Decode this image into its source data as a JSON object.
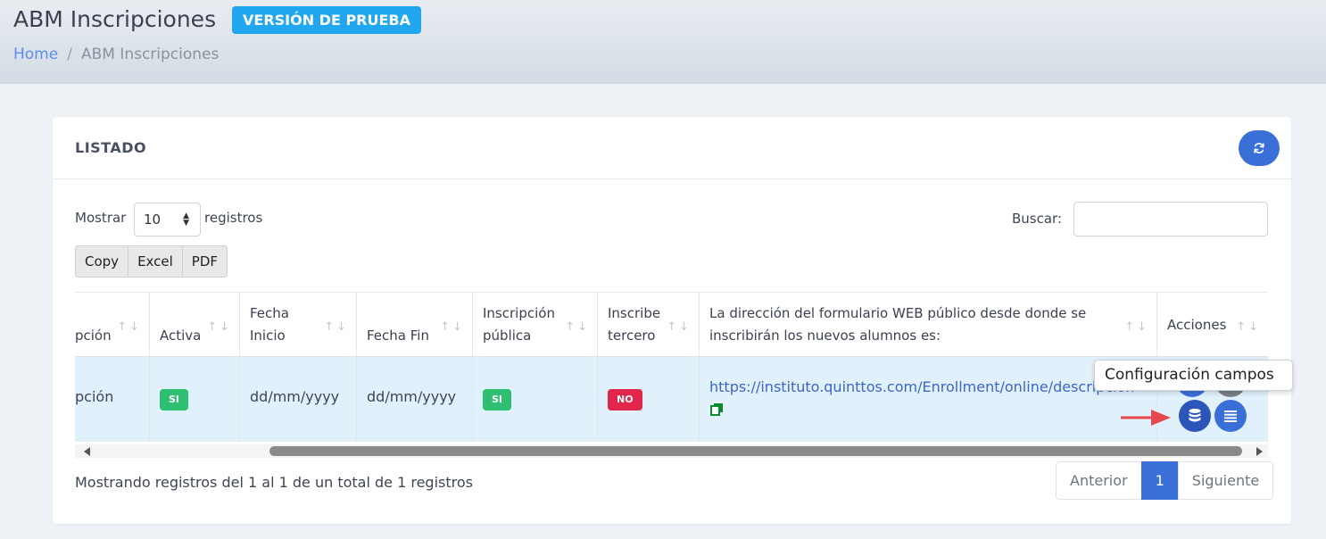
{
  "header": {
    "title": "ABM Inscripciones",
    "trial_badge": "VERSIÓN DE PRUEBA",
    "breadcrumb": {
      "home": "Home",
      "separator": "/",
      "current": "ABM Inscripciones"
    }
  },
  "card": {
    "title": "LISTADO",
    "refresh_icon": "refresh-icon"
  },
  "controls": {
    "show_label": "Mostrar",
    "page_length": "10",
    "records_label": "registros",
    "search_label": "Buscar:",
    "search_value": "",
    "export_buttons": [
      "Copy",
      "Excel",
      "PDF"
    ]
  },
  "table": {
    "columns": [
      "pción",
      "Activa",
      "Fecha Inicio",
      "Fecha Fin",
      "Inscripción pública",
      "Inscribe tercero",
      "La dirección del formulario WEB público desde donde se inscribirán los nuevos alumnos es:",
      "Acciones"
    ],
    "sort_glyph": "↑↓",
    "rows": [
      {
        "descripcion": "pción",
        "activa": "SI",
        "fecha_inicio": "dd/mm/yyyy",
        "fecha_fin": "dd/mm/yyyy",
        "publica": "SI",
        "tercero": "NO",
        "url": "https://instituto.quinttos.com/Enrollment/online/descripcion"
      }
    ]
  },
  "tooltip": "Configuración campos",
  "footer": {
    "info": "Mostrando registros del 1 al 1 de un total de 1 registros",
    "prev": "Anterior",
    "page": "1",
    "next": "Siguiente"
  },
  "colors": {
    "primary": "#3b6fd8",
    "badge_trial": "#21a7f0",
    "si": "#2fbf71",
    "no": "#e0264b",
    "row_highlight": "#e1f1fc",
    "arrow": "#e5484d"
  }
}
